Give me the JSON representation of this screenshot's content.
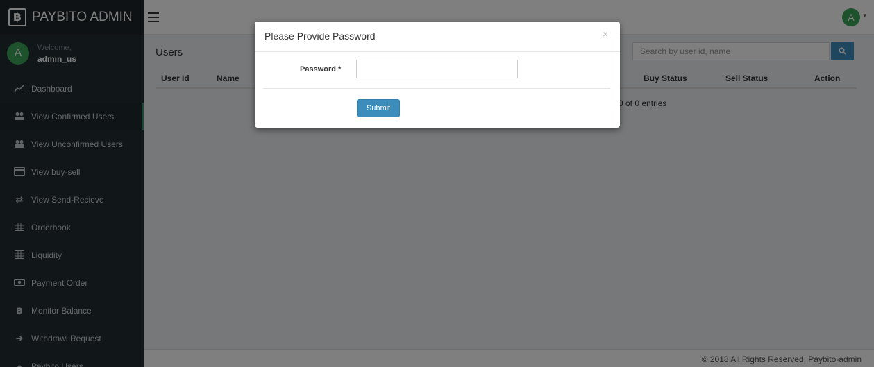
{
  "brand": {
    "logo_glyph": "฿",
    "name": "PAYBITO ADMIN"
  },
  "user": {
    "avatar_letter": "A",
    "welcome": "Welcome,",
    "username": "admin_us"
  },
  "sidebar": {
    "items": [
      {
        "label": "Dashboard",
        "icon": "line-chart-icon",
        "glyph": "📈"
      },
      {
        "label": "View Confirmed Users",
        "icon": "users-icon",
        "glyph": "👥",
        "active": true
      },
      {
        "label": "View Unconfirmed Users",
        "icon": "users-icon",
        "glyph": "👥"
      },
      {
        "label": "View buy-sell",
        "icon": "credit-card-icon",
        "glyph": "▭"
      },
      {
        "label": "View Send-Recieve",
        "icon": "exchange-icon",
        "glyph": "⇄"
      },
      {
        "label": "Orderbook",
        "icon": "table-icon",
        "glyph": "▦"
      },
      {
        "label": "Liquidity",
        "icon": "table-icon",
        "glyph": "▦"
      },
      {
        "label": "Payment Order",
        "icon": "money-icon",
        "glyph": "▣"
      },
      {
        "label": "Monitor Balance",
        "icon": "bitcoin-icon",
        "glyph": "฿"
      },
      {
        "label": "Withdrawl Request",
        "icon": "sign-in-icon",
        "glyph": "➜"
      },
      {
        "label": "Paybito Users",
        "icon": "user-icon",
        "glyph": "●"
      }
    ]
  },
  "header": {
    "avatar_letter": "A"
  },
  "main": {
    "title": "Users",
    "search_placeholder": "Search by user id, name",
    "columns": [
      "User Id",
      "Name",
      "Buy Status",
      "Sell Status",
      "Action"
    ],
    "entries_text": "0 of 0 entries"
  },
  "footer": {
    "copyright": "© 2018 All Rights Reserved. Paybito-admin"
  },
  "modal": {
    "title": "Please Provide Password",
    "close": "×",
    "password_label": "Password",
    "required_mark": "*",
    "password_value": "",
    "submit_label": "Submit"
  },
  "colors": {
    "sidebar": "#222d32",
    "accent": "#3c8dbc",
    "avatar": "#3ba45a"
  }
}
